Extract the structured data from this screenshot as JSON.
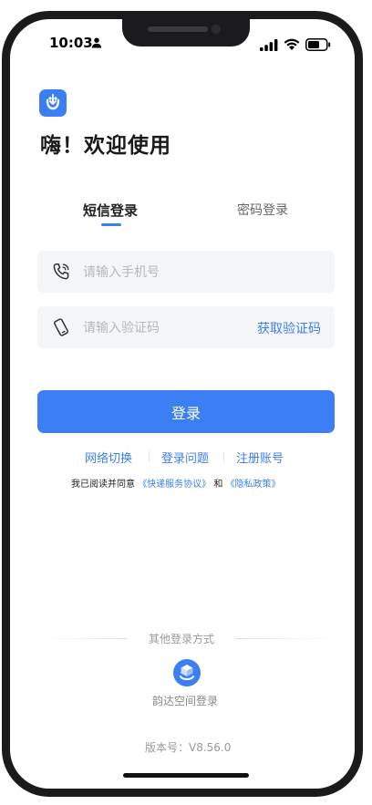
{
  "status_bar": {
    "time": "10:03",
    "icons": [
      "person-icon",
      "signal-icon",
      "wifi-icon",
      "battery-icon"
    ]
  },
  "app": {
    "logo_icon": "yunda-logo-icon",
    "welcome_title": "嗨！欢迎使用"
  },
  "tabs": [
    {
      "label": "短信登录",
      "active": true
    },
    {
      "label": "密码登录",
      "active": false
    }
  ],
  "form": {
    "phone_placeholder": "请输入手机号",
    "phone_icon": "phone-icon",
    "code_placeholder": "请输入验证码",
    "code_icon": "mobile-phone-icon",
    "get_code_label": "获取验证码",
    "login_label": "登录"
  },
  "links": [
    "网络切换",
    "登录问题",
    "注册账号"
  ],
  "agreement": {
    "prefix": "我已阅读并同意",
    "service": "《快递服务协议》",
    "conjunction": "和",
    "privacy": "《隐私政策》"
  },
  "other_login": {
    "label": "其他登录方式",
    "yunda_icon": "yunda-space-icon",
    "yunda_label": "韵达空间登录"
  },
  "version": "版本号：V8.56.0",
  "colors": {
    "accent": "#3c7ef3",
    "field_bg": "#f4f5f7",
    "frame": "#1b1b1d"
  }
}
